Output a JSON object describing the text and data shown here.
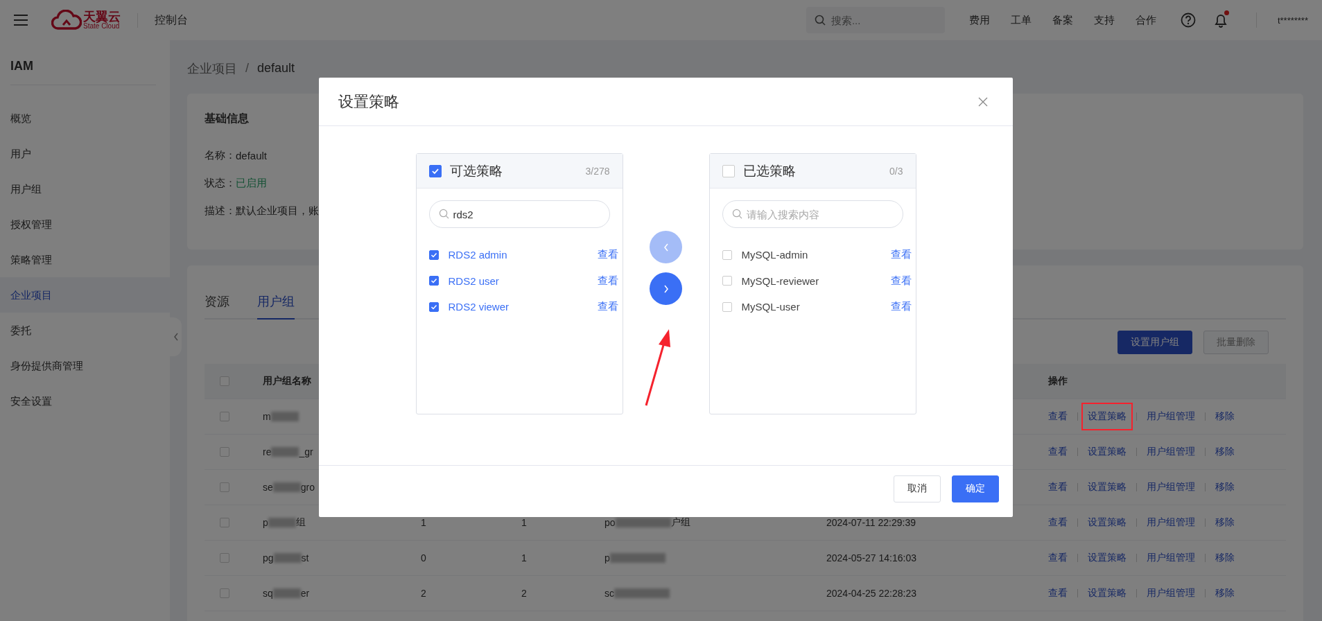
{
  "topbar": {
    "logo_name": "天翼云",
    "logo_sub": "State Cloud",
    "console": "控制台",
    "search_placeholder": "搜索...",
    "links": [
      "费用",
      "工单",
      "备案",
      "支持",
      "合作"
    ],
    "notification_dot": true,
    "user": "t********"
  },
  "sidebar": {
    "title": "IAM",
    "items": [
      {
        "label": "概览",
        "selected": false
      },
      {
        "label": "用户",
        "selected": false
      },
      {
        "label": "用户组",
        "selected": false
      },
      {
        "label": "授权管理",
        "selected": false
      },
      {
        "label": "策略管理",
        "selected": false
      },
      {
        "label": "企业项目",
        "selected": true
      },
      {
        "label": "委托",
        "selected": false
      },
      {
        "label": "身份提供商管理",
        "selected": false
      },
      {
        "label": "安全设置",
        "selected": false
      }
    ]
  },
  "breadcrumb": {
    "items": [
      "企业项目",
      "default"
    ],
    "separator": "/"
  },
  "info": {
    "title": "基础信息",
    "fields": [
      {
        "label": "名称：",
        "value": "default",
        "kind": "plain"
      },
      {
        "label": "状态：",
        "value": "已启用",
        "kind": "status"
      },
      {
        "label": "描述：",
        "value": "默认企业项目，账",
        "kind": "plain"
      }
    ]
  },
  "tabs": [
    {
      "label": "资源",
      "selected": false
    },
    {
      "label": "用户组",
      "selected": true
    }
  ],
  "actions": [
    {
      "label": "设置用户组",
      "kind": "primary",
      "disabled": false
    },
    {
      "label": "批量删除",
      "kind": "default",
      "disabled": true
    }
  ],
  "table": {
    "header_checked": false,
    "name_header": "用户组名称",
    "ops_header": "操作",
    "rows": [
      {
        "checked": false,
        "name": [
          {
            "kind": "text",
            "text": "m"
          },
          {
            "kind": "blur"
          }
        ],
        "ops": [
          {
            "label": "查看",
            "highlighted": false
          },
          {
            "label": "设置策略",
            "highlighted": true
          },
          {
            "label": "用户组管理",
            "highlighted": false
          },
          {
            "label": "移除",
            "highlighted": false
          }
        ]
      },
      {
        "checked": false,
        "name": [
          {
            "kind": "text",
            "text": "re"
          },
          {
            "kind": "blur"
          },
          {
            "kind": "text",
            "text": "_gr"
          }
        ],
        "ops": [
          {
            "label": "查看",
            "highlighted": false
          },
          {
            "label": "设置策略",
            "highlighted": false
          },
          {
            "label": "用户组管理",
            "highlighted": false
          },
          {
            "label": "移除",
            "highlighted": false
          }
        ]
      },
      {
        "checked": false,
        "name": [
          {
            "kind": "text",
            "text": "se"
          },
          {
            "kind": "blur"
          },
          {
            "kind": "text",
            "text": "gro"
          }
        ],
        "ops": [
          {
            "label": "查看",
            "highlighted": false
          },
          {
            "label": "设置策略",
            "highlighted": false
          },
          {
            "label": "用户组管理",
            "highlighted": false
          },
          {
            "label": "移除",
            "highlighted": false
          }
        ]
      },
      {
        "checked": false,
        "name": [
          {
            "kind": "text",
            "text": "p"
          },
          {
            "kind": "blur"
          },
          {
            "kind": "text",
            "text": "组"
          }
        ],
        "column_2": "1",
        "column_3": "1",
        "column_4": [
          {
            "kind": "text",
            "text": "po"
          },
          {
            "kind": "blur"
          },
          {
            "kind": "text",
            "text": "户组"
          }
        ],
        "time": "2024-07-11 22:29:39",
        "ops": [
          {
            "label": "查看",
            "highlighted": false
          },
          {
            "label": "设置策略",
            "highlighted": false
          },
          {
            "label": "用户组管理",
            "highlighted": false
          },
          {
            "label": "移除",
            "highlighted": false
          }
        ]
      },
      {
        "checked": false,
        "name": [
          {
            "kind": "text",
            "text": "pg"
          },
          {
            "kind": "blur"
          },
          {
            "kind": "text",
            "text": "st"
          }
        ],
        "column_2": "0",
        "column_3": "1",
        "column_4": [
          {
            "kind": "text",
            "text": "p"
          },
          {
            "kind": "blur"
          }
        ],
        "time": "2024-05-27 14:16:03",
        "ops": [
          {
            "label": "查看",
            "highlighted": false
          },
          {
            "label": "设置策略",
            "highlighted": false
          },
          {
            "label": "用户组管理",
            "highlighted": false
          },
          {
            "label": "移除",
            "highlighted": false
          }
        ]
      },
      {
        "checked": false,
        "name": [
          {
            "kind": "text",
            "text": "sq"
          },
          {
            "kind": "blur"
          },
          {
            "kind": "text",
            "text": "er"
          }
        ],
        "column_2": "2",
        "column_3": "2",
        "column_4": [
          {
            "kind": "text",
            "text": "sc"
          },
          {
            "kind": "blur"
          }
        ],
        "time": "2024-04-25 22:28:23",
        "ops": [
          {
            "label": "查看",
            "highlighted": false
          },
          {
            "label": "设置策略",
            "highlighted": false
          },
          {
            "label": "用户组管理",
            "highlighted": false
          },
          {
            "label": "移除",
            "highlighted": false
          }
        ]
      }
    ]
  },
  "modal": {
    "title": "设置策略",
    "panels": [
      {
        "title": "可选策略",
        "count": "3/278",
        "checked": true,
        "search": {
          "value": "rds2"
        },
        "items": [
          {
            "name": "RDS2 admin",
            "checked": true,
            "link": "查看"
          },
          {
            "name": "RDS2 user",
            "checked": true,
            "link": "查看"
          },
          {
            "name": "RDS2 viewer",
            "checked": true,
            "link": "查看"
          }
        ]
      },
      {
        "title": "已选策略",
        "count": "0/3",
        "checked": false,
        "search": {
          "placeholder": "请输入搜索内容"
        },
        "items": [
          {
            "name": "MySQL-admin",
            "checked": false,
            "link": "查看"
          },
          {
            "name": "MySQL-reviewer",
            "checked": false,
            "link": "查看"
          },
          {
            "name": "MySQL-user",
            "checked": false,
            "link": "查看"
          }
        ]
      }
    ],
    "move_buttons": [
      {
        "kind": "back",
        "disabled": true
      },
      {
        "kind": "forward",
        "disabled": false
      }
    ],
    "buttons": [
      {
        "label": "取消",
        "kind": "default"
      },
      {
        "label": "确定",
        "kind": "primary"
      }
    ]
  }
}
